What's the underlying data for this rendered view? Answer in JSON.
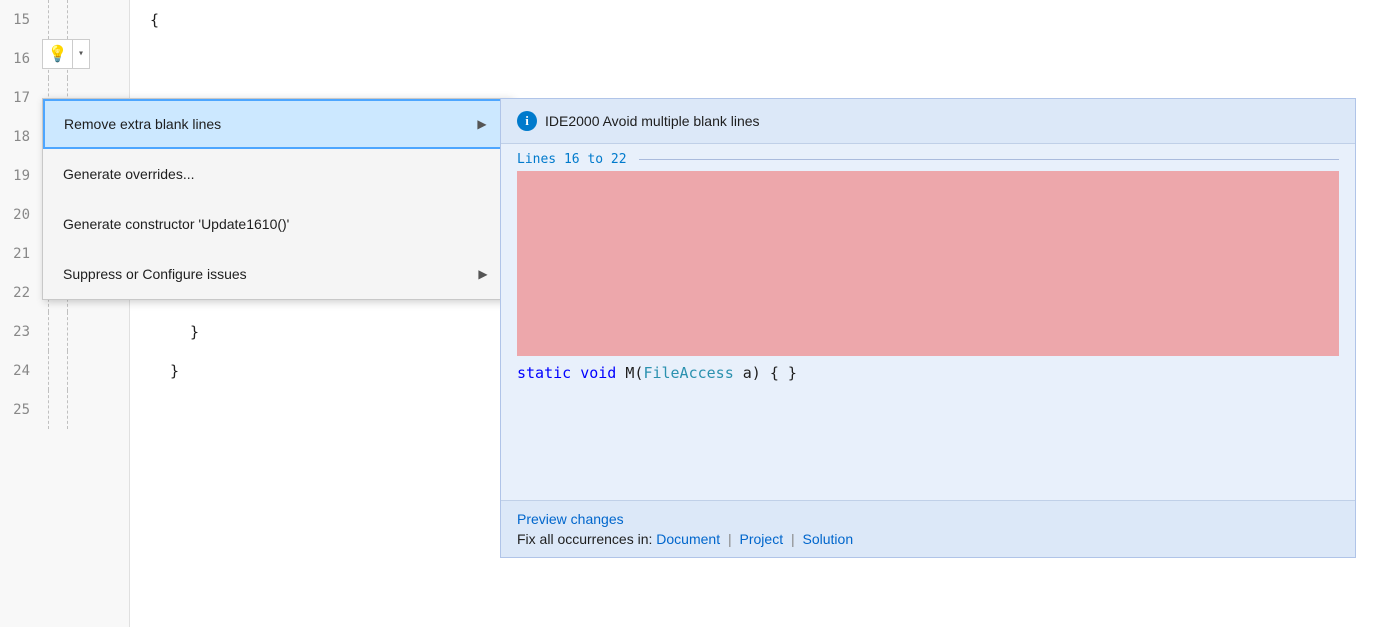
{
  "editor": {
    "lines": [
      {
        "number": "15",
        "indent": 0,
        "content": "{",
        "type": "brace"
      },
      {
        "number": "16",
        "indent": 0,
        "content": "",
        "type": "blank"
      },
      {
        "number": "17",
        "indent": 0,
        "content": "",
        "type": "blank"
      },
      {
        "number": "18",
        "indent": 0,
        "content": "",
        "type": "blank"
      },
      {
        "number": "19",
        "indent": 0,
        "content": "",
        "type": "blank"
      },
      {
        "number": "20",
        "indent": 0,
        "content": "",
        "type": "blank"
      },
      {
        "number": "21",
        "indent": 0,
        "content": "",
        "type": "blank"
      },
      {
        "number": "22",
        "indent": 4,
        "content": "static voi",
        "type": "code"
      },
      {
        "number": "23",
        "indent": 4,
        "content": "}",
        "type": "brace"
      },
      {
        "number": "24",
        "indent": 2,
        "content": "}",
        "type": "brace"
      },
      {
        "number": "25",
        "indent": 0,
        "content": "",
        "type": "blank"
      }
    ]
  },
  "lightbulb": {
    "icon": "💡",
    "dropdown_arrow": "▾"
  },
  "context_menu": {
    "items": [
      {
        "id": "remove-blank-lines",
        "label": "Remove extra blank lines",
        "has_submenu": true,
        "highlighted": true
      },
      {
        "id": "generate-overrides",
        "label": "Generate overrides...",
        "has_submenu": false,
        "highlighted": false
      },
      {
        "id": "generate-constructor",
        "label": "Generate constructor 'Update1610()'",
        "has_submenu": false,
        "highlighted": false
      },
      {
        "id": "suppress-configure",
        "label": "Suppress or Configure issues",
        "has_submenu": true,
        "highlighted": false
      }
    ]
  },
  "preview_panel": {
    "info_icon": "i",
    "title": "IDE2000  Avoid multiple blank lines",
    "range_label": "Lines 16 to 22",
    "code_preview": "static void M(FileAccess a) { }",
    "footer": {
      "preview_changes_label": "Preview changes",
      "fix_all_prefix": "Fix all occurrences in: ",
      "fix_links": [
        "Document",
        "Project",
        "Solution"
      ],
      "separator": "|"
    }
  },
  "colors": {
    "highlight_bg": "#cce8ff",
    "highlight_border": "#4da6ff",
    "preview_bg": "#e8f0fb",
    "preview_header_bg": "#dce8f8",
    "info_icon_bg": "#007acc",
    "link_color": "#0066cc",
    "code_blue": "#007acc",
    "code_keyword": "#0000ff",
    "code_type": "#2b91af",
    "deleted_bg": "#f08080"
  }
}
